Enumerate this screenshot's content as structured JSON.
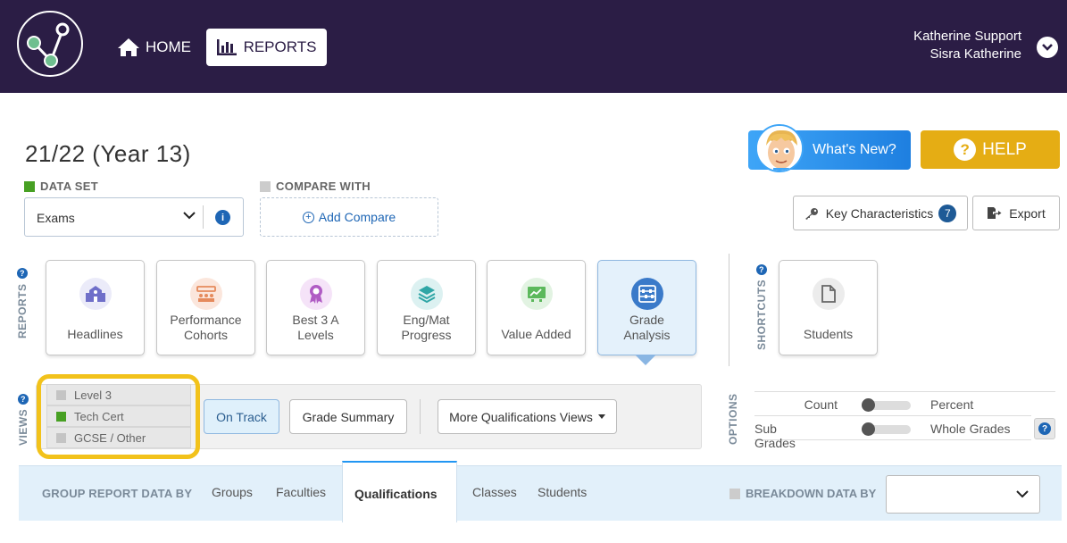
{
  "header": {
    "nav_home": "HOME",
    "nav_reports": "REPORTS",
    "user_name": "Katherine Support",
    "org_name": "Sisra Katherine"
  },
  "title": "21/22 (Year 13)",
  "whats_new": "What's New?",
  "help": "HELP",
  "dataset": {
    "label": "DATA SET",
    "value": "Exams",
    "color": "#47a023"
  },
  "compare": {
    "label": "COMPARE WITH",
    "button": "Add Compare"
  },
  "key_characteristics": {
    "label": "Key Characteristics",
    "count": "7"
  },
  "export": "Export",
  "sections": {
    "reports": "REPORTS",
    "shortcuts": "SHORTCUTS",
    "views": "VIEWS",
    "options": "OPTIONS"
  },
  "reports": [
    {
      "line1": "Headlines",
      "line2": "",
      "icon": "school-icon",
      "color": "#6f6fc9"
    },
    {
      "line1": "Performance",
      "line2": "Cohorts",
      "icon": "cohorts-icon",
      "color": "#e58a5c"
    },
    {
      "line1": "Best 3 A",
      "line2": "Levels",
      "icon": "ribbon-icon",
      "color": "#b05cc4"
    },
    {
      "line1": "Eng/Mat",
      "line2": "Progress",
      "icon": "layers-icon",
      "color": "#2fa6a6"
    },
    {
      "line1": "Value Added",
      "line2": "",
      "icon": "chart-board-icon",
      "color": "#5cb85c"
    },
    {
      "line1": "Grade",
      "line2": "Analysis",
      "icon": "abacus-icon",
      "color": "#3a7ac9",
      "active": true
    }
  ],
  "shortcuts": [
    {
      "label": "Students",
      "icon": "document-icon"
    }
  ],
  "qualifications": [
    {
      "label": "Level 3",
      "selected": false
    },
    {
      "label": "Tech Cert",
      "selected": true
    },
    {
      "label": "GCSE / Other",
      "selected": false
    }
  ],
  "views": {
    "on_track": "On Track",
    "grade_summary": "Grade Summary",
    "more": "More Qualifications Views"
  },
  "options": [
    {
      "left": "Count",
      "right": "Percent"
    },
    {
      "left": "Sub Grades",
      "right": "Whole Grades"
    }
  ],
  "group_by": {
    "label": "GROUP REPORT DATA BY",
    "tabs": [
      "Groups",
      "Faculties",
      "Qualifications",
      "Classes",
      "Students"
    ],
    "active": "Qualifications"
  },
  "breakdown": {
    "label": "BREAKDOWN DATA BY",
    "value": ""
  }
}
